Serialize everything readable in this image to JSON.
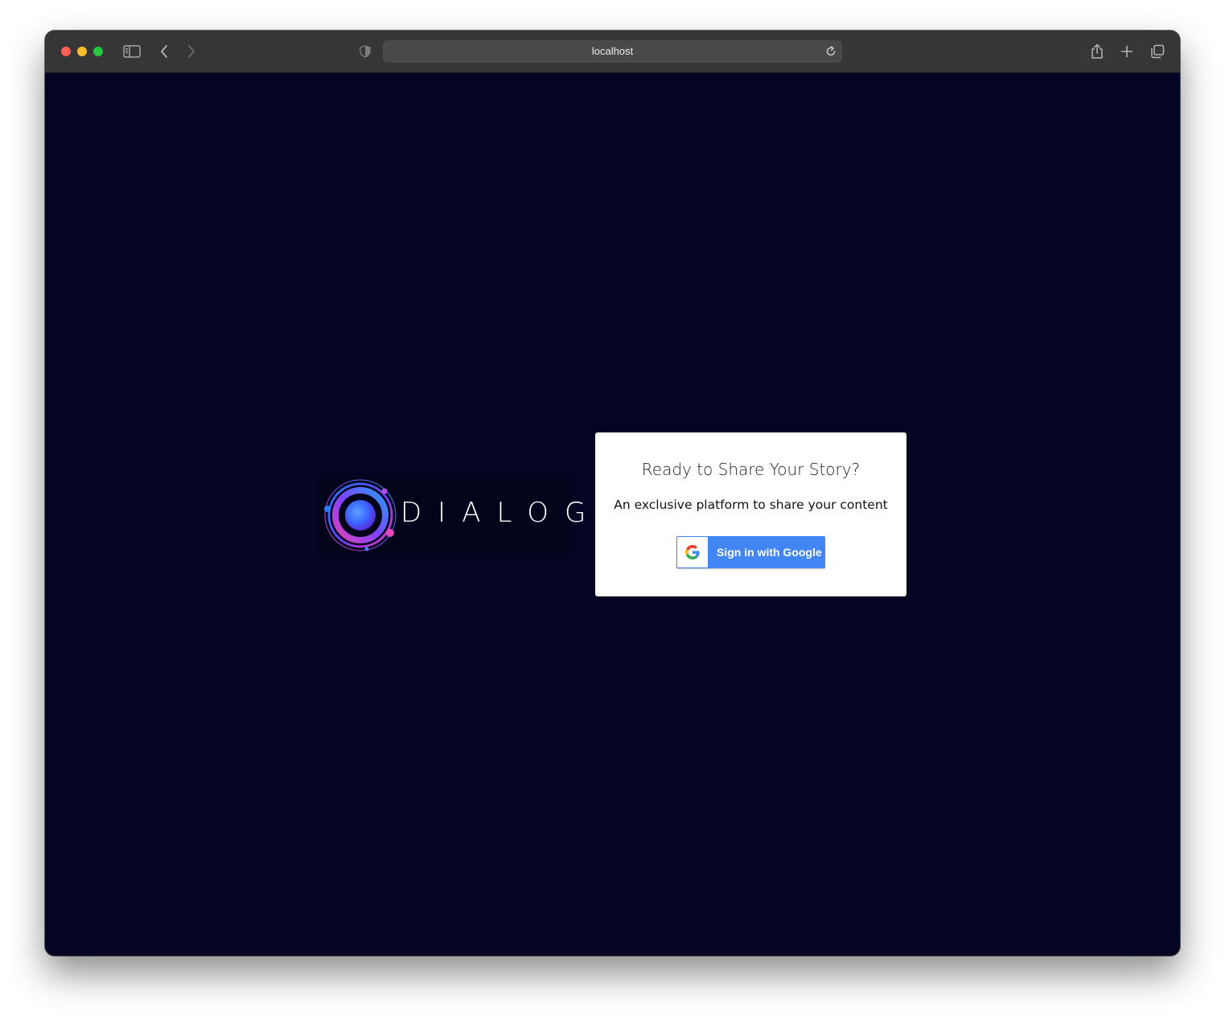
{
  "browser": {
    "url": "localhost",
    "icons": {
      "close": "close-dot-icon",
      "minimize": "minimize-dot-icon",
      "maximize": "maximize-dot-icon",
      "sidebar": "sidebar-icon",
      "back": "back-chevron-icon",
      "forward": "forward-chevron-icon",
      "privacy": "shield-icon",
      "reload": "reload-icon",
      "share": "share-icon",
      "new_tab": "plus-icon",
      "tabs": "tab-overview-icon"
    },
    "colors": {
      "toolbar": "#373636",
      "address_bar": "#4a4949"
    }
  },
  "page": {
    "background": "#030522",
    "logo": {
      "text": "DIALOG",
      "icon": "orbit-logo-icon"
    },
    "card": {
      "title": "Ready to Share Your Story?",
      "subtitle": "An exclusive platform to share your content",
      "google_button": {
        "label": "Sign in with Google",
        "icon": "google-g-icon",
        "color": "#4285f4"
      }
    }
  }
}
